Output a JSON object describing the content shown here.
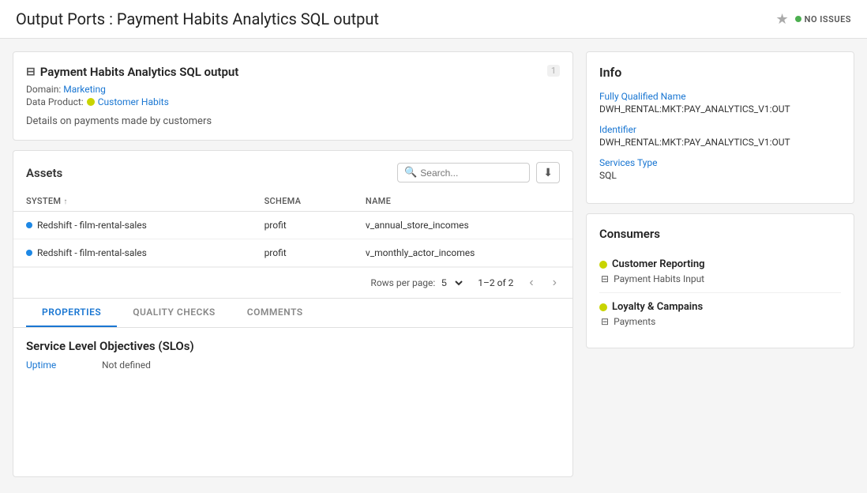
{
  "header": {
    "title": "Output Ports : Payment Habits Analytics SQL output",
    "no_issues_label": "NO ISSUES"
  },
  "output_card": {
    "icon": "⊟",
    "title": "Payment Habits Analytics SQL output",
    "number": "1",
    "domain_label": "Domain:",
    "domain_value": "Marketing",
    "data_product_label": "Data Product:",
    "data_product_value": "Customer Habits",
    "description": "Details on payments made by customers"
  },
  "info_panel": {
    "title": "Info",
    "fully_qualified_name_label": "Fully Qualified Name",
    "fully_qualified_name_value": "DWH_RENTAL:MKT:PAY_ANALYTICS_V1:OUT",
    "identifier_label": "Identifier",
    "identifier_value": "DWH_RENTAL:MKT:PAY_ANALYTICS_V1:OUT",
    "services_type_label": "Services Type",
    "services_type_value": "SQL"
  },
  "assets": {
    "title": "Assets",
    "search_placeholder": "Search...",
    "columns": [
      "System",
      "Schema",
      "Name"
    ],
    "rows": [
      {
        "system": "Redshift - film-rental-sales",
        "schema": "profit",
        "name": "v_annual_store_incomes"
      },
      {
        "system": "Redshift - film-rental-sales",
        "schema": "profit",
        "name": "v_monthly_actor_incomes"
      }
    ],
    "rows_per_page_label": "Rows per page:",
    "rows_per_page_value": "5",
    "pagination": "1–2 of 2"
  },
  "tabs": [
    {
      "label": "PROPERTIES",
      "active": true
    },
    {
      "label": "QUALITY CHECKS",
      "active": false
    },
    {
      "label": "COMMENTS",
      "active": false
    }
  ],
  "slo": {
    "title": "Service Level Objectives (SLOs)",
    "uptime_label": "Uptime",
    "uptime_value": "Not defined"
  },
  "consumers": {
    "title": "Consumers",
    "items": [
      {
        "name": "Customer Reporting",
        "port": "Payment Habits Input",
        "port_icon": "⊟"
      },
      {
        "name": "Loyalty & Campains",
        "port": "Payments",
        "port_icon": "⊟"
      }
    ]
  }
}
